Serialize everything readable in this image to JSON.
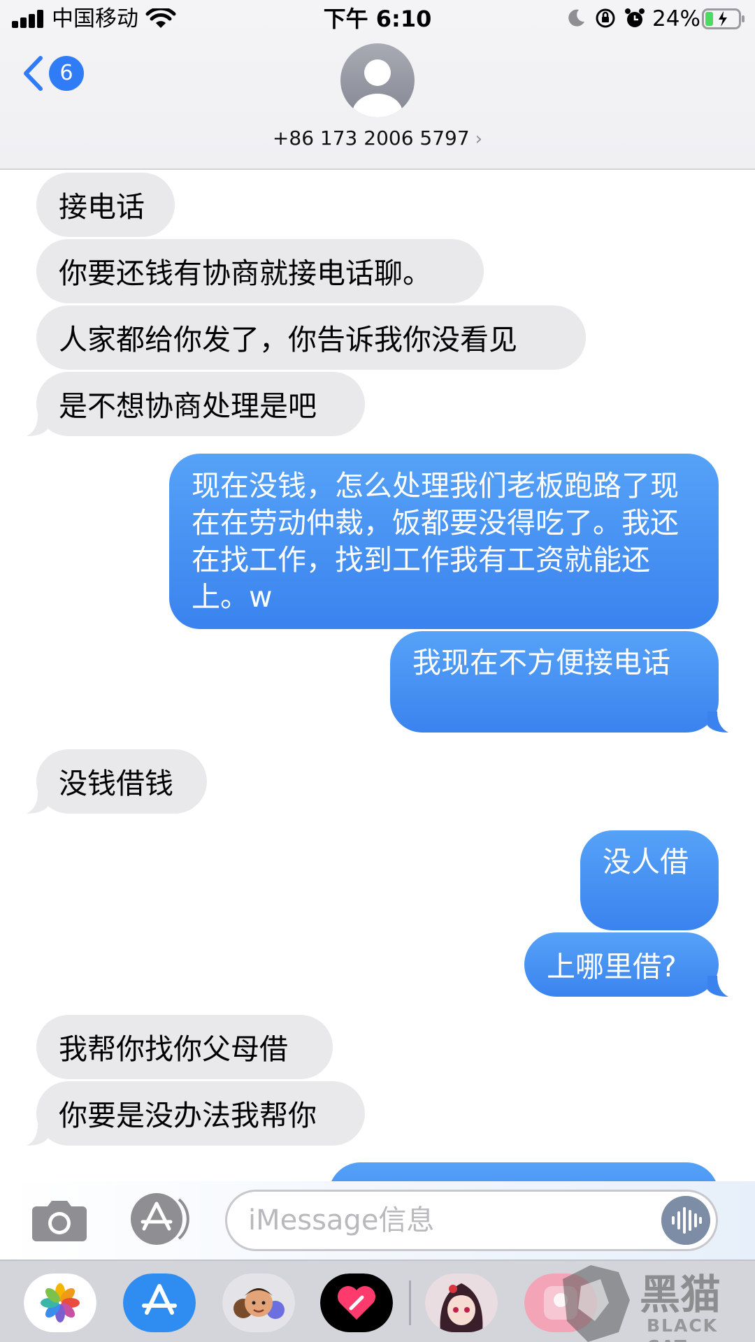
{
  "status_bar": {
    "carrier": "中国移动",
    "time": "下午 6:10",
    "battery_percent": "24%",
    "battery_level": 0.24,
    "icons": [
      "signal-icon",
      "wifi-icon",
      "moon-icon",
      "rotation-lock-icon",
      "alarm-icon",
      "battery-icon"
    ]
  },
  "nav": {
    "back_badge": "6",
    "contact_number": "+86 173 2006 5797",
    "contact_chevron": "›"
  },
  "messages": [
    {
      "direction": "in",
      "text": "接电话"
    },
    {
      "direction": "in",
      "text": "你要还钱有协商就接电话聊。"
    },
    {
      "direction": "in",
      "text": "人家都给你发了，你告诉我你没看见"
    },
    {
      "direction": "in",
      "text": "是不想协商处理是吧"
    },
    {
      "direction": "out",
      "text": "现在没钱，怎么处理我们老板跑路了现在在劳动仲裁，饭都要没得吃了。我还在找工作，找到工作我有工资就能还上。w"
    },
    {
      "direction": "out",
      "text": "我现在不方便接电话"
    },
    {
      "direction": "in",
      "text": "没钱借钱"
    },
    {
      "direction": "out",
      "text": "没人借"
    },
    {
      "direction": "out",
      "text": "上哪里借?"
    },
    {
      "direction": "in",
      "text": "我帮你找你父母借"
    },
    {
      "direction": "in",
      "text": "你要是没办法我帮你"
    }
  ],
  "input_bar": {
    "placeholder": "iMessage信息"
  },
  "app_drawer": {
    "apps": [
      "photos-icon",
      "app-store-icon",
      "memoji-icon",
      "digital-touch-icon",
      "anime-sticker-icon",
      "pink-app-icon"
    ]
  },
  "watermark": {
    "text_cn": "黑猫",
    "text_latin": "BLACK CAT"
  },
  "colors": {
    "incoming_bubble": "#e9e9eb",
    "outgoing_bubble": "#3a83ef",
    "accent": "#2f7cf6"
  }
}
